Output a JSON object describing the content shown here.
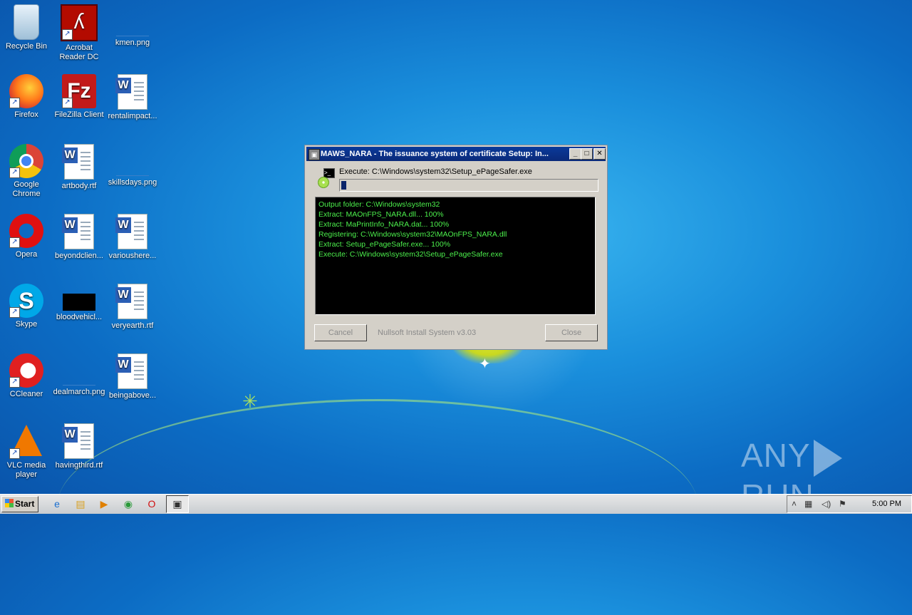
{
  "desktop": {
    "icons": [
      {
        "label": "Recycle Bin"
      },
      {
        "label": "Acrobat Reader DC"
      },
      {
        "label": "kmen.png"
      },
      {
        "label": "Firefox"
      },
      {
        "label": "FileZilla Client"
      },
      {
        "label": "rentalimpact..."
      },
      {
        "label": "Google Chrome"
      },
      {
        "label": "artbody.rtf"
      },
      {
        "label": "skillsdays.png"
      },
      {
        "label": "Opera"
      },
      {
        "label": "beyondclien..."
      },
      {
        "label": "varioushere..."
      },
      {
        "label": "Skype"
      },
      {
        "label": "bloodvehicl..."
      },
      {
        "label": "veryearth.rtf"
      },
      {
        "label": "CCleaner"
      },
      {
        "label": "dealmarch.png"
      },
      {
        "label": "beingabove..."
      },
      {
        "label": "VLC media player"
      },
      {
        "label": "havingthird.rtf"
      }
    ]
  },
  "dialog": {
    "title": "MAWS_NARA - The issuance system of certificate Setup: In...",
    "execute_text": "Execute: C:\\Windows\\system32\\Setup_ePageSafer.exe",
    "progress_fraction": 0.02,
    "log": [
      "Output folder: C:\\Windows\\system32",
      "Extract: MAOnFPS_NARA.dll... 100%",
      "Extract: MaPrintInfo_NARA.dat... 100%",
      "Registering: C:\\Windows\\system32\\MAOnFPS_NARA.dll",
      "Extract: Setup_ePageSafer.exe... 100%",
      "Execute: C:\\Windows\\system32\\Setup_ePageSafer.exe"
    ],
    "cancel_label": "Cancel",
    "branding": "Nullsoft Install System v3.03",
    "close_label": "Close",
    "minimize_glyph": "_",
    "maximize_glyph": "□",
    "close_glyph": "✕"
  },
  "taskbar": {
    "start_label": "Start",
    "clock": "5:00 PM"
  },
  "watermark": {
    "left": "ANY",
    "right": "RUN"
  }
}
